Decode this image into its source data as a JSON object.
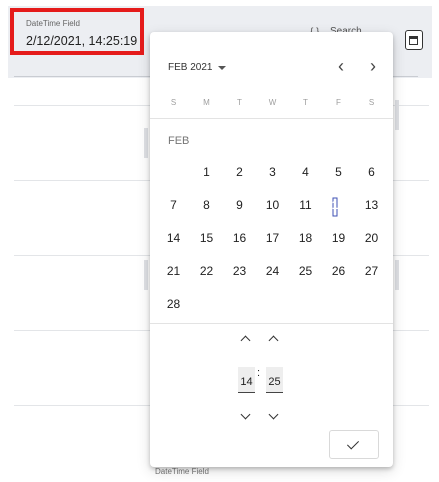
{
  "field": {
    "label": "DateTime Field",
    "value": "2/12/2021, 14:25:19"
  },
  "background": {
    "search_label": "Search",
    "search_icon": "{ }",
    "calendar_button_icon": "calendar-icon",
    "bottom_label": "DateTime Field"
  },
  "picker": {
    "month_year": "FEB 2021",
    "prev_icon": "‹",
    "next_icon": "›",
    "weekdays": [
      "S",
      "M",
      "T",
      "W",
      "T",
      "F",
      "S"
    ],
    "month_label": "FEB",
    "days": [
      "1",
      "2",
      "3",
      "4",
      "5",
      "6",
      "7",
      "8",
      "9",
      "10",
      "11",
      "12",
      "13",
      "14",
      "15",
      "16",
      "17",
      "18",
      "19",
      "20",
      "21",
      "22",
      "23",
      "24",
      "25",
      "26",
      "27",
      "28"
    ],
    "first_weekday_index": 1,
    "selected_day": "12",
    "accent_color": "#3f51b5",
    "hour": "14",
    "minute": "25",
    "time_separator": ":",
    "ok_icon": "check-icon"
  }
}
